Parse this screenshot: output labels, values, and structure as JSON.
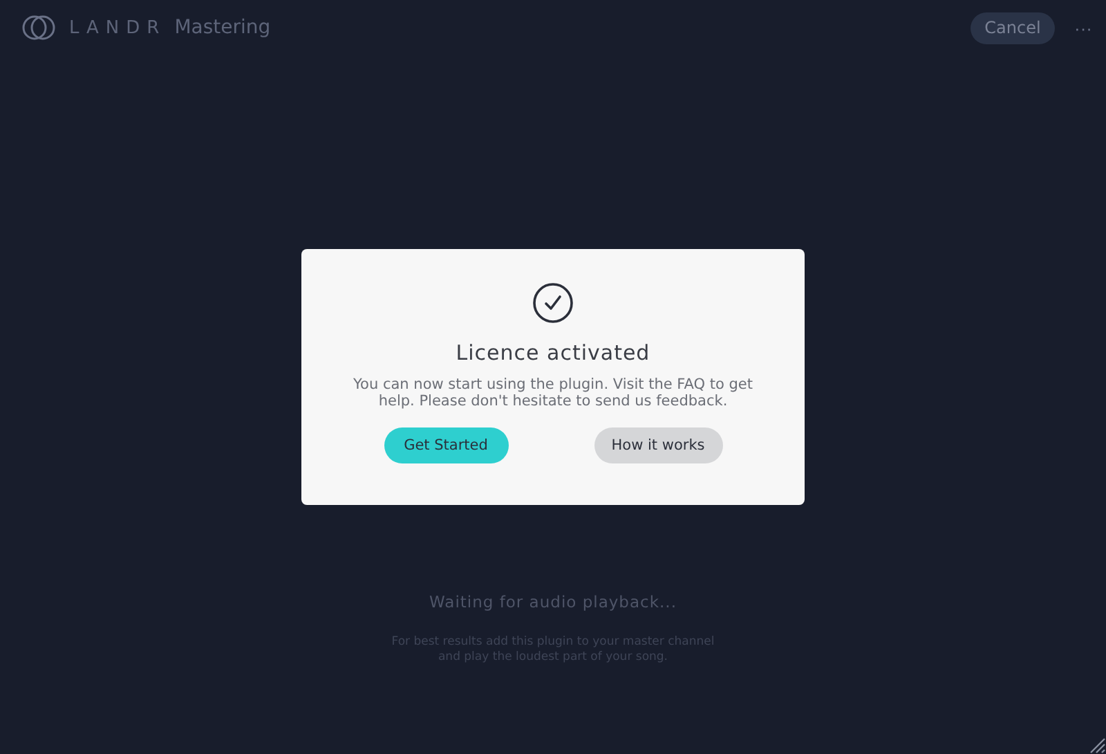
{
  "header": {
    "logo": "LANDR",
    "product": "Mastering",
    "cancel_button": "Cancel",
    "menu_button": "···"
  },
  "dialog": {
    "title": "Licence activated",
    "message": "You can now start using the plugin. Visit the FAQ to get help. Please don't hesitate to send us feedback.",
    "buttons": [
      {
        "label": "Get Started",
        "kind": "primary"
      },
      {
        "label": "How it works",
        "kind": "secondary"
      }
    ]
  },
  "status": {
    "waiting": "Waiting for audio playback...",
    "hint_lines": [
      "For best results add this plugin to your master channel",
      "and play the loudest part of your song."
    ]
  }
}
